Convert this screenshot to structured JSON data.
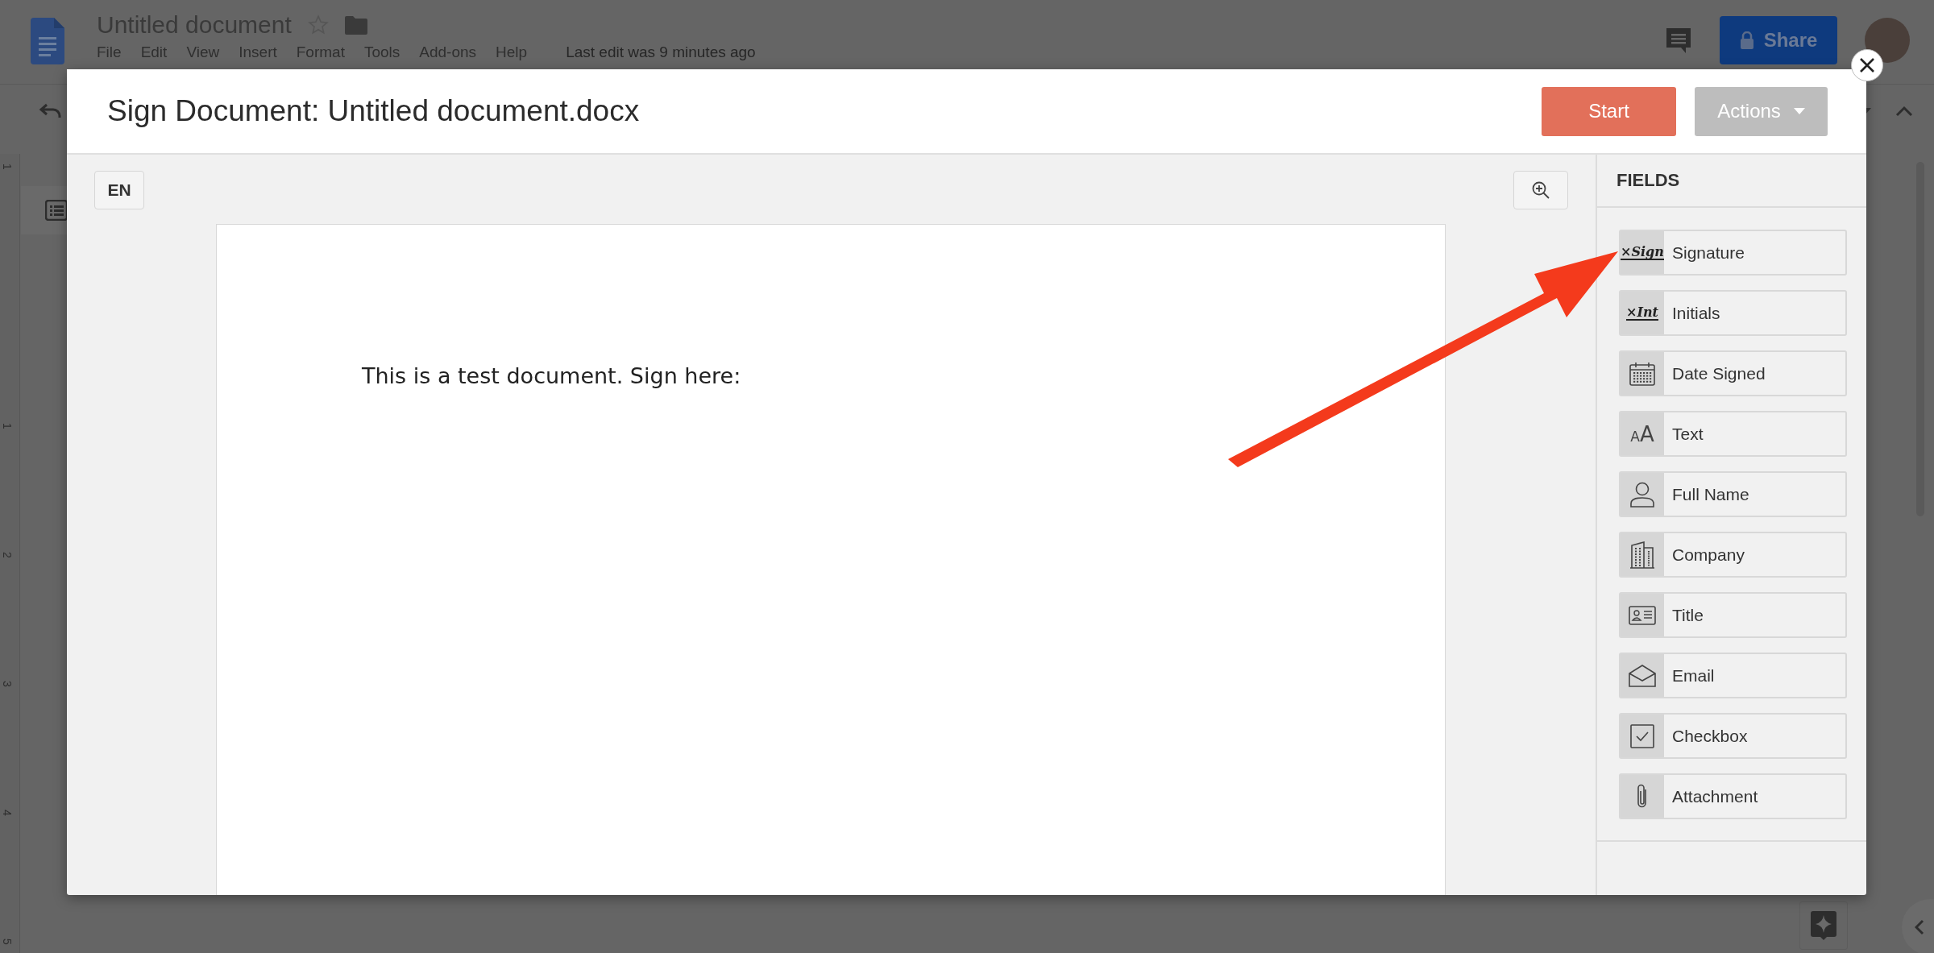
{
  "docs": {
    "title": "Untitled document",
    "menu": [
      "File",
      "Edit",
      "View",
      "Insert",
      "Format",
      "Tools",
      "Add-ons",
      "Help"
    ],
    "last_edit": "Last edit was 9 minutes ago",
    "share_label": "Share",
    "ruler_marks": [
      "1",
      "1",
      "2",
      "3",
      "4",
      "5"
    ]
  },
  "dialog": {
    "title": "Sign Document: Untitled document.docx",
    "buttons": [
      {
        "label": "Start",
        "kind": "primary"
      },
      {
        "label": "Actions",
        "kind": "menu"
      }
    ],
    "language": "EN",
    "document_text": "This is a test document. Sign here:"
  },
  "fields_panel": {
    "heading": "FIELDS",
    "fields": [
      {
        "label": "Signature",
        "kind": "signature",
        "icon_text": "×Sign"
      },
      {
        "label": "Initials",
        "kind": "initials",
        "icon_text": "×Int"
      },
      {
        "label": "Date Signed",
        "kind": "date"
      },
      {
        "label": "Text",
        "kind": "text",
        "icon_text": "AA"
      },
      {
        "label": "Full Name",
        "kind": "person"
      },
      {
        "label": "Company",
        "kind": "company"
      },
      {
        "label": "Title",
        "kind": "title"
      },
      {
        "label": "Email",
        "kind": "email"
      },
      {
        "label": "Checkbox",
        "kind": "checkbox"
      },
      {
        "label": "Attachment",
        "kind": "attachment"
      }
    ]
  }
}
